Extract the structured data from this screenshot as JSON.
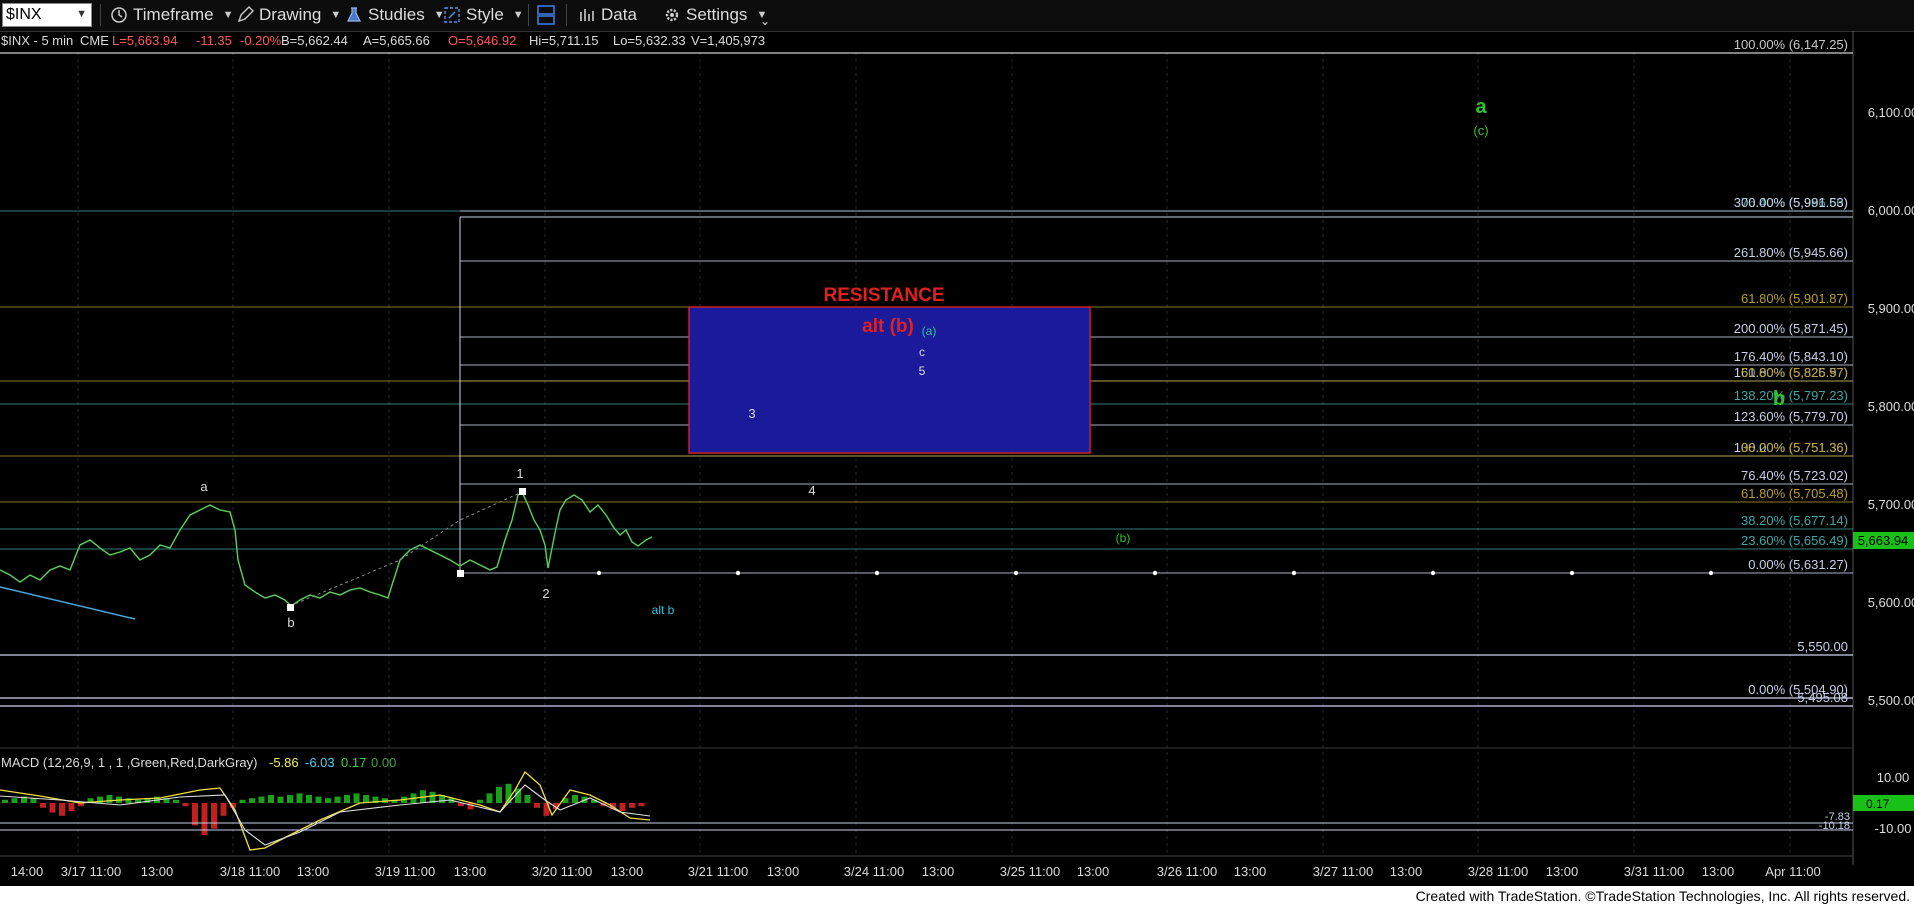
{
  "toolbar": {
    "symbol": "$INX",
    "timeframe": "Timeframe",
    "drawing": "Drawing",
    "studies": "Studies",
    "style": "Style",
    "data": "Data",
    "settings": "Settings"
  },
  "header": {
    "symbol": "$INX - 5 min",
    "exchange": "CME",
    "last": "L=5,663.94",
    "change": "-11.35",
    "change_pct": "-0.20%",
    "bid": "B=5,662.44",
    "ask": "A=5,665.66",
    "open": "O=5,646.92",
    "high": "Hi=5,711.15",
    "low": "Lo=5,632.33",
    "volume": "V=1,405,973"
  },
  "price_axis": {
    "ticks": [
      "6,100.00",
      "6,000.00",
      "5,900.00",
      "5,800.00",
      "5,700.00",
      "5,600.00",
      "5,500.00"
    ],
    "current_price": "5,663.94"
  },
  "macd": {
    "title": "MACD (12,26,9, 1 , 1 ,Green,Red,DarkGray)",
    "v1": "-5.86",
    "v2": "-6.03",
    "v3": "0.17",
    "v4": "0.00",
    "axis": [
      "10.00",
      "-10.00"
    ],
    "current": "0.17",
    "low_labels": [
      "-7.83",
      "-10.18"
    ]
  },
  "time_axis": [
    "14:00",
    "3/17 11:00",
    "13:00",
    "3/18 11:00",
    "13:00",
    "3/19 11:00",
    "13:00",
    "3/20 11:00",
    "13:00",
    "3/21 11:00",
    "13:00",
    "3/24 11:00",
    "13:00",
    "3/25 11:00",
    "13:00",
    "3/26 11:00",
    "13:00",
    "3/27 11:00",
    "13:00",
    "3/28 11:00",
    "13:00",
    "3/31 11:00",
    "13:00",
    "Apr 11:00"
  ],
  "fib_levels": [
    {
      "label": "100.00% (6,147.25)",
      "color": "#c8c8c8"
    },
    {
      "label": "76.40% (5,986.66)",
      "color": "#3fa6a6"
    },
    {
      "label": "300.00% (5,991.53)",
      "color": "#c8d0e8"
    },
    {
      "label": "261.80% (5,945.66)",
      "color": "#c8d0e8"
    },
    {
      "label": "61.80% (5,901.87)",
      "color": "#b8a02a"
    },
    {
      "label": "200.00% (5,871.45)",
      "color": "#c8d0e8"
    },
    {
      "label": "176.40% (5,843.10)",
      "color": "#c8d0e8"
    },
    {
      "label": "161.80% (5,825.57)",
      "color": "#c8d0e8"
    },
    {
      "label": "50.00% (5,826.97)",
      "color": "#b8a02a"
    },
    {
      "label": "138.20% (5,797.23)",
      "color": "#3fa6a6"
    },
    {
      "label": "123.60% (5,779.70)",
      "color": "#c8d0e8"
    },
    {
      "label": "100.00% (5,751.36)",
      "color": "#c8d0e8"
    },
    {
      "label": "38.20% (5,751.36)",
      "color": "#b8a02a"
    },
    {
      "label": "76.40% (5,723.02)",
      "color": "#c8d0e8"
    },
    {
      "label": "61.80% (5,705.48)",
      "color": "#b8a02a"
    },
    {
      "label": "38.20% (5,677.14)",
      "color": "#3fa6a6"
    },
    {
      "label": "23.60% (5,656.49)",
      "color": "#3fa6a6"
    },
    {
      "label": "0.00% (5,631.27)",
      "color": "#c8d0e8"
    },
    {
      "label": "5,550.00",
      "color": "#c8d0e8"
    },
    {
      "label": "0.00% (5,504.90)",
      "color": "#c8d0e8"
    },
    {
      "label": "5,495.08",
      "color": "#c8d0e8"
    }
  ],
  "annotations": {
    "resistance": "RESISTANCE",
    "alt_b_red": "alt (b)",
    "wave_a_paren": "(a)",
    "wave_c": "c",
    "wave_5": "5",
    "wave_3": "3",
    "wave_4": "4",
    "wave_1": "1",
    "wave_2": "2",
    "wave_a_low": "a",
    "wave_b_low": "b",
    "alt_b_cyan": "alt b",
    "wave_b_paren": "(b)",
    "wave_big_a": "a",
    "wave_c_paren": "(c)",
    "wave_big_b": "b"
  },
  "colors": {
    "resistance_fill": "#1a1a9a",
    "resistance_border": "#d02020",
    "red_label": "#e02020",
    "green_label": "#30c030",
    "up_tick": "#1aa01a",
    "down_tick": "#c02020"
  },
  "footer": "Created with TradeStation. ©TradeStation Technologies, Inc. All rights reserved."
}
